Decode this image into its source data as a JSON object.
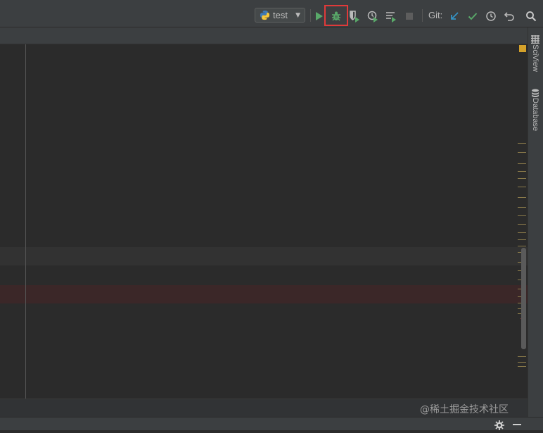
{
  "toolbar": {
    "run_config_label": "test",
    "git_label": "Git:"
  },
  "right_panel": {
    "sciview_label": "SciView",
    "database_label": "Database"
  },
  "watermark": "@稀土掘金技术社区",
  "colors": {
    "run_green": "#59a869",
    "debug_green": "#59a869",
    "highlight_red": "#e03a3a",
    "git_update_blue": "#3592c4",
    "git_commit_green": "#59a869",
    "warning_yellow": "#d4a12a"
  },
  "icons": [
    "python-icon",
    "run-icon",
    "debug-icon",
    "coverage-icon",
    "profile-icon",
    "concurrency-icon",
    "stop-icon",
    "git-update-icon",
    "git-commit-icon",
    "git-history-icon",
    "rollback-icon",
    "search-icon",
    "settings-icon",
    "minimize-icon"
  ]
}
